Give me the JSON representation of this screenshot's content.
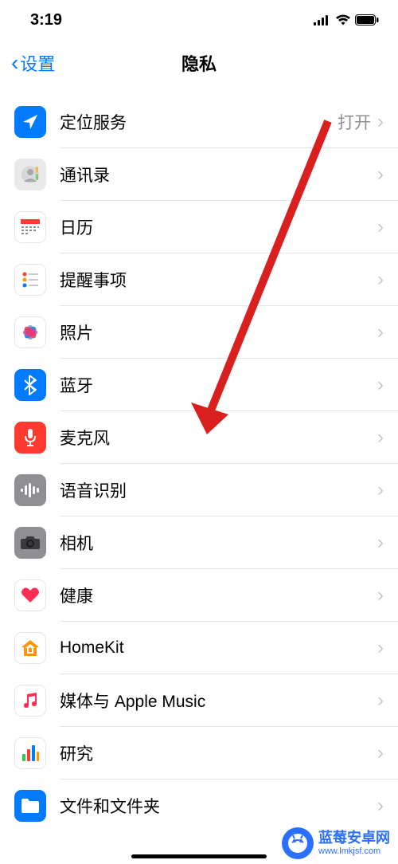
{
  "status_bar": {
    "time": "3:19"
  },
  "nav": {
    "back_label": "设置",
    "title": "隐私"
  },
  "rows": [
    {
      "id": "location",
      "label": "定位服务",
      "value": "打开",
      "icon": "location-icon"
    },
    {
      "id": "contacts",
      "label": "通讯录",
      "value": "",
      "icon": "contacts-icon"
    },
    {
      "id": "calendar",
      "label": "日历",
      "value": "",
      "icon": "calendar-icon"
    },
    {
      "id": "reminders",
      "label": "提醒事项",
      "value": "",
      "icon": "reminders-icon"
    },
    {
      "id": "photos",
      "label": "照片",
      "value": "",
      "icon": "photos-icon"
    },
    {
      "id": "bluetooth",
      "label": "蓝牙",
      "value": "",
      "icon": "bluetooth-icon"
    },
    {
      "id": "microphone",
      "label": "麦克风",
      "value": "",
      "icon": "microphone-icon"
    },
    {
      "id": "speech",
      "label": "语音识别",
      "value": "",
      "icon": "speech-icon"
    },
    {
      "id": "camera",
      "label": "相机",
      "value": "",
      "icon": "camera-icon"
    },
    {
      "id": "health",
      "label": "健康",
      "value": "",
      "icon": "health-icon"
    },
    {
      "id": "homekit",
      "label": "HomeKit",
      "value": "",
      "icon": "homekit-icon"
    },
    {
      "id": "media",
      "label": "媒体与 Apple Music",
      "value": "",
      "icon": "media-icon"
    },
    {
      "id": "research",
      "label": "研究",
      "value": "",
      "icon": "research-icon"
    },
    {
      "id": "files",
      "label": "文件和文件夹",
      "value": "",
      "icon": "files-icon"
    }
  ],
  "watermark": {
    "title": "蓝莓安卓网",
    "url": "www.lmkjsf.com"
  }
}
